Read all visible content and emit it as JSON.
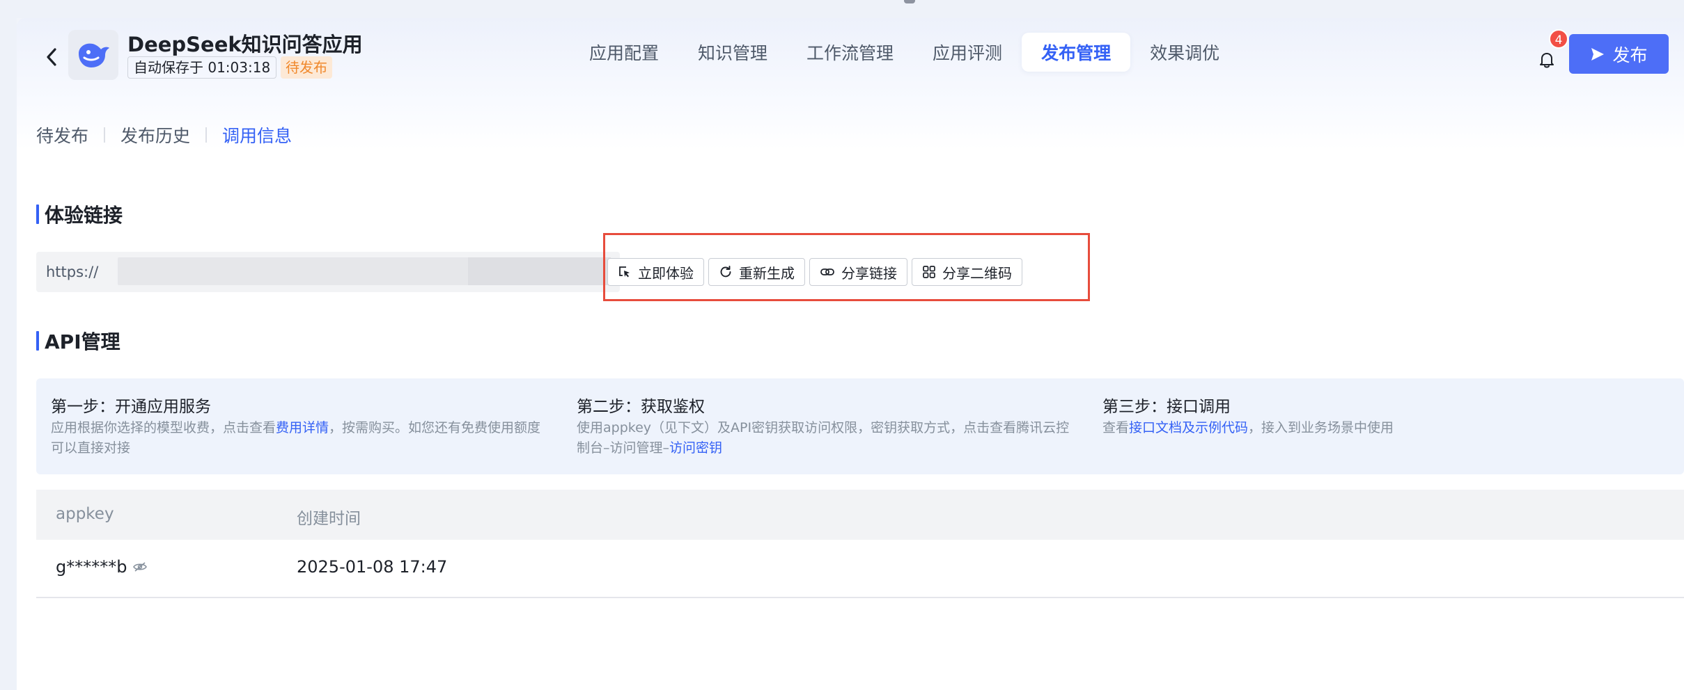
{
  "header": {
    "app_name": "DeepSeek知识问答应用",
    "autosave_text": "自动保存于 01:03:18",
    "status": "待发布",
    "notification_count": "4",
    "publish_label": "发布"
  },
  "nav": {
    "tabs": [
      {
        "label": "应用配置"
      },
      {
        "label": "知识管理"
      },
      {
        "label": "工作流管理"
      },
      {
        "label": "应用评测"
      },
      {
        "label": "发布管理",
        "active": true
      },
      {
        "label": "效果调优"
      }
    ]
  },
  "subtabs": [
    {
      "label": "待发布"
    },
    {
      "label": "发布历史"
    },
    {
      "label": "调用信息",
      "active": true
    }
  ],
  "experience": {
    "title": "体验链接",
    "url_prefix": "https://",
    "buttons": {
      "try_now": "立即体验",
      "regenerate": "重新生成",
      "share_link": "分享链接",
      "share_qr": "分享二维码"
    }
  },
  "api": {
    "title": "API管理",
    "steps": [
      {
        "title": "第一步：开通应用服务",
        "desc_before": "应用根据你选择的模型收费，点击查看",
        "link": "费用详情",
        "desc_after": "，按需购买。如您还有免费使用额度可以直接对接"
      },
      {
        "title": "第二步：获取鉴权",
        "desc_before": "使用appkey（见下文）及API密钥获取访问权限，密钥获取方式，点击查看腾讯云控制台–访问管理–",
        "link": "访问密钥",
        "desc_after": ""
      },
      {
        "title": "第三步：接口调用",
        "desc_before": "查看",
        "link": "接口文档及示例代码",
        "desc_after": "，接入到业务场景中使用"
      }
    ],
    "table": {
      "columns": [
        "appkey",
        "创建时间"
      ],
      "rows": [
        {
          "appkey": "g******b",
          "created": "2025-01-08 17:47"
        }
      ]
    }
  },
  "colors": {
    "accent": "#3461f5",
    "publish_button": "#4d6ef7",
    "badge_text": "#f0882b",
    "highlight_box": "#e74c3c",
    "notification": "#f24f45"
  }
}
